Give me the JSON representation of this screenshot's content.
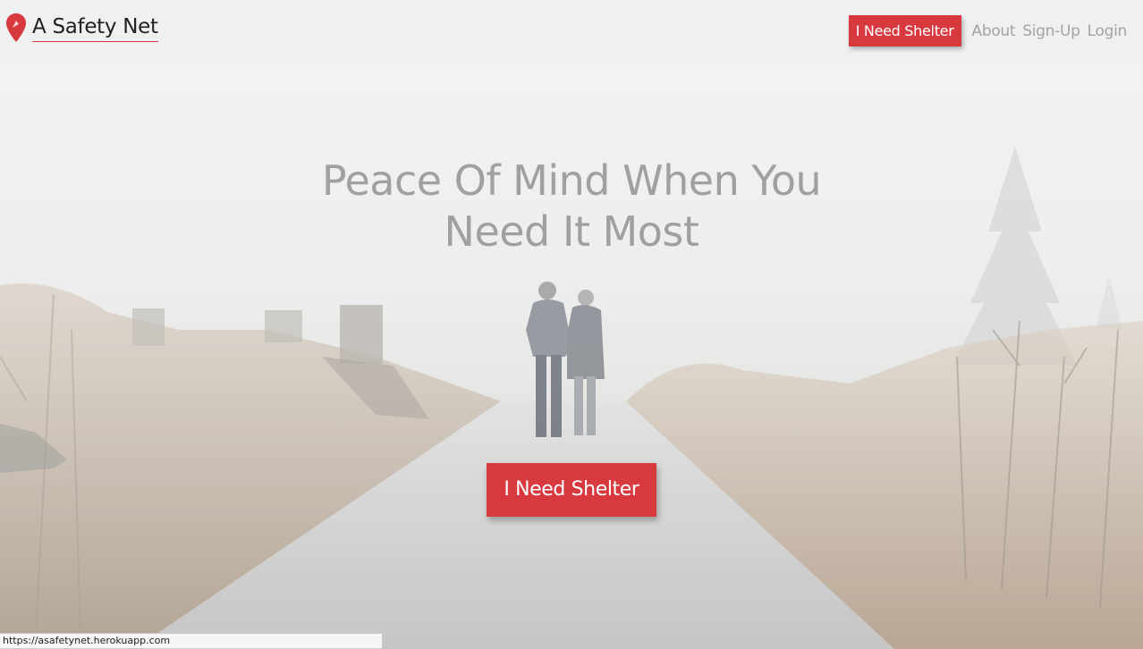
{
  "navbar": {
    "brand": "A Safety Net",
    "brand_icon": "map-pin-icon",
    "accent_color": "#d8393f",
    "cta_label": "I Need Shelter",
    "links": [
      "About",
      "Sign-Up",
      "Login"
    ]
  },
  "hero": {
    "headline_line1": "Peace Of Mind When You",
    "headline_line2": "Need It Most",
    "cta_label": "I Need Shelter"
  },
  "status_bar": {
    "url": "https://asafetynet.herokuapp.com"
  }
}
